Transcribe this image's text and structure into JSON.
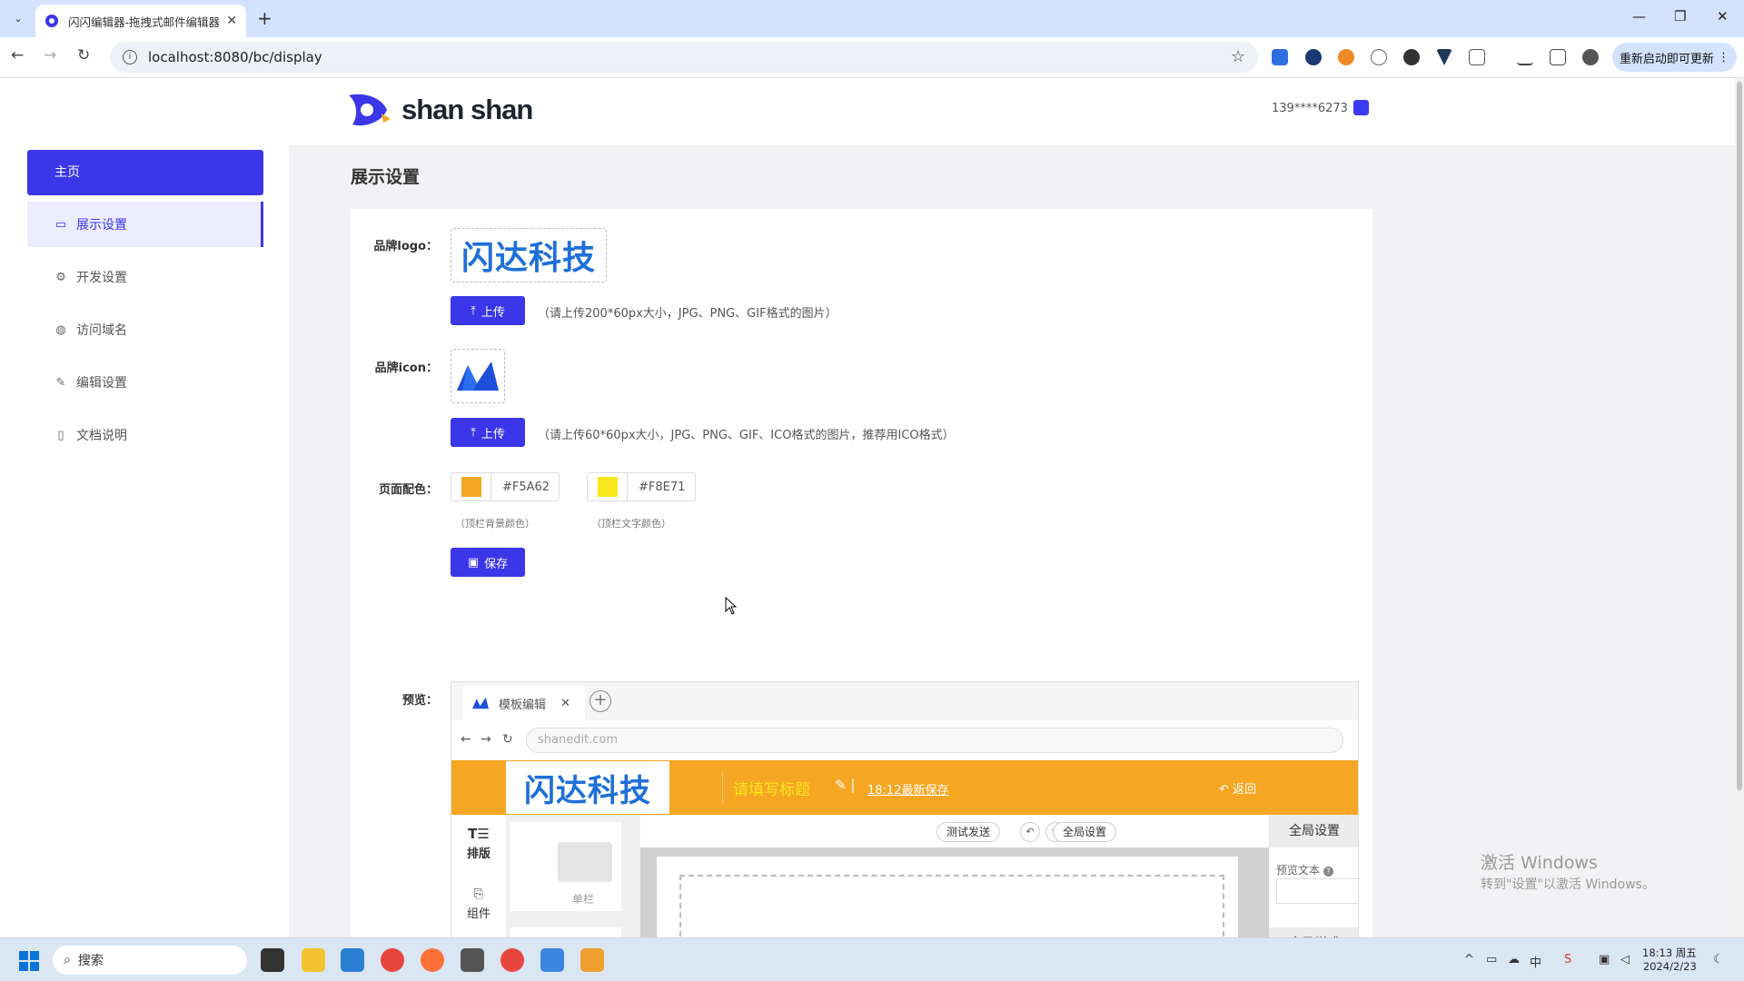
{
  "browser": {
    "tab_title": "闪闪编辑器-拖拽式邮件编辑器",
    "url": "localhost:8080/bc/display",
    "update_label": "重新启动即可更新"
  },
  "header": {
    "logo_text": "shan shan",
    "user_phone": "139****6273"
  },
  "sidebar": {
    "home": "主页",
    "items": [
      {
        "label": "展示设置",
        "icon": "monitor-icon"
      },
      {
        "label": "开发设置",
        "icon": "gear-icon"
      },
      {
        "label": "访问域名",
        "icon": "globe-icon"
      },
      {
        "label": "编辑设置",
        "icon": "pen-icon"
      },
      {
        "label": "文档说明",
        "icon": "doc-icon"
      }
    ]
  },
  "content": {
    "title": "展示设置",
    "logo_label": "品牌logo：",
    "brand_logo_text": "闪达科技",
    "upload_label": "上传",
    "logo_hint": "（请上传200*60px大小，JPG、PNG、GIF格式的图片）",
    "icon_label": "品牌icon：",
    "icon_hint": "（请上传60*60px大小，JPG、PNG、GIF、ICO格式的图片，推荐用ICO格式）",
    "color_label": "页面配色：",
    "color1": "#F5A62",
    "color1_note": "（顶栏背景颜色）",
    "color2": "#F8E71",
    "color2_note": "（顶栏文字颜色）",
    "save_label": "保存",
    "preview_label": "预览："
  },
  "preview": {
    "tab_label": "模板编辑",
    "url": "shanedit.com",
    "logo_text": "闪达科技",
    "title_placeholder": "请填写标题",
    "last_saved": "18:12最新保存",
    "back": "返回",
    "left_layout": "排版",
    "left_component": "组件",
    "module_single": "单栏",
    "btn_test": "测试发送",
    "btn_global": "全局设置",
    "right_global": "全局设置",
    "preview_text": "预览文本",
    "right_style": "全局样式"
  },
  "watermark": {
    "line1": "激活 Windows",
    "line2": "转到\"设置\"以激活 Windows。"
  },
  "taskbar": {
    "search": "搜索",
    "time": "18:13 周五",
    "date": "2024/2/23"
  },
  "colors": {
    "accent": "#3B36E8",
    "topbar_bg": "#F5A623",
    "topbar_text": "#F8E71C",
    "brand_blue": "#1E6FD8"
  }
}
